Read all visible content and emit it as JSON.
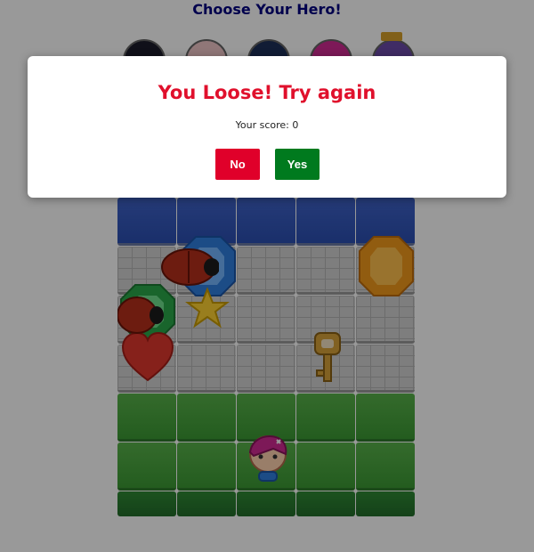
{
  "header": {
    "title": "Choose Your Hero!"
  },
  "heroes": [
    {
      "name": "ninja",
      "icon": "ninja-hero-icon"
    },
    {
      "name": "pig",
      "icon": "pig-hero-icon"
    },
    {
      "name": "navy",
      "icon": "star-cap-hero-icon"
    },
    {
      "name": "pink",
      "icon": "pink-hair-hero-icon"
    },
    {
      "name": "king",
      "icon": "crown-hero-icon"
    }
  ],
  "modal": {
    "title": "You Loose! Try again",
    "score_label": "Your score:",
    "score_value": "0",
    "no_label": "No",
    "yes_label": "Yes"
  },
  "colors": {
    "title": "#000080",
    "modal_title": "#e0102c",
    "no_button": "#e0002a",
    "yes_button": "#007a1e",
    "overlay": "rgba(0,0,0,0.40)"
  },
  "board": {
    "rows": [
      [
        "water",
        "water",
        "water",
        "water",
        "water"
      ],
      [
        "stone",
        "stone",
        "stone",
        "stone",
        "stone"
      ],
      [
        "stone",
        "stone",
        "stone",
        "stone",
        "stone"
      ],
      [
        "stone",
        "stone",
        "stone",
        "stone",
        "stone"
      ],
      [
        "grass",
        "grass",
        "grass",
        "grass",
        "grass"
      ],
      [
        "grass",
        "grass",
        "grass",
        "grass",
        "grass"
      ]
    ],
    "items": [
      {
        "type": "blue-gem",
        "icon": "blue-gem-icon",
        "col": 1,
        "row": 1
      },
      {
        "type": "orange-gem",
        "icon": "orange-gem-icon",
        "col": 4,
        "row": 1
      },
      {
        "type": "green-gem",
        "icon": "green-gem-icon",
        "col": 0,
        "row": 2
      },
      {
        "type": "star",
        "icon": "star-icon",
        "col": 1,
        "row": 2
      },
      {
        "type": "heart",
        "icon": "heart-icon",
        "col": 0,
        "row": 3
      },
      {
        "type": "key",
        "icon": "key-icon",
        "col": 3,
        "row": 3
      },
      {
        "type": "bug-1",
        "icon": "ladybug-enemy-icon",
        "col": 1,
        "row": 1
      },
      {
        "type": "bug-2",
        "icon": "ladybug-enemy-icon",
        "col": 0,
        "row": 2
      },
      {
        "type": "player",
        "icon": "player-hero-icon",
        "col": 2,
        "row": 5
      }
    ]
  }
}
